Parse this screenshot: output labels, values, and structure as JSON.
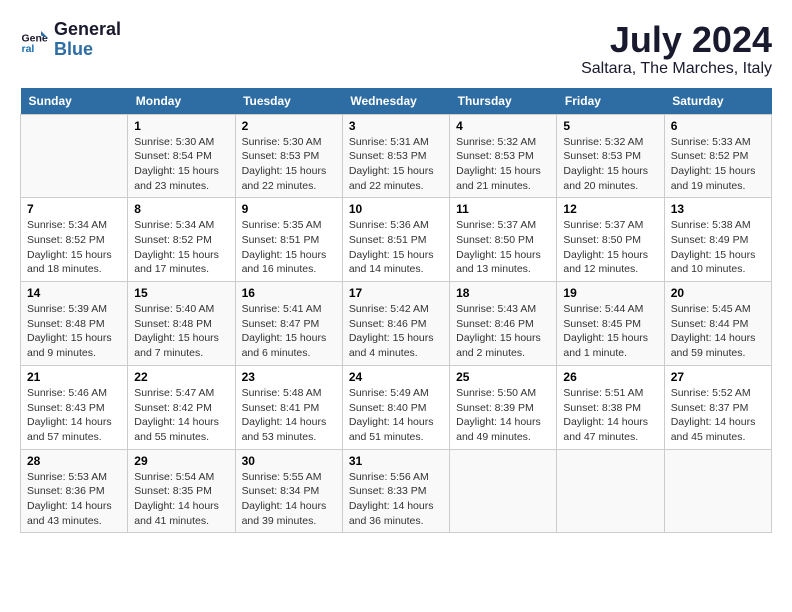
{
  "header": {
    "logo_line1": "General",
    "logo_line2": "Blue",
    "title": "July 2024",
    "subtitle": "Saltara, The Marches, Italy"
  },
  "calendar": {
    "days_of_week": [
      "Sunday",
      "Monday",
      "Tuesday",
      "Wednesday",
      "Thursday",
      "Friday",
      "Saturday"
    ],
    "weeks": [
      [
        {
          "day": "",
          "info": ""
        },
        {
          "day": "1",
          "info": "Sunrise: 5:30 AM\nSunset: 8:54 PM\nDaylight: 15 hours\nand 23 minutes."
        },
        {
          "day": "2",
          "info": "Sunrise: 5:30 AM\nSunset: 8:53 PM\nDaylight: 15 hours\nand 22 minutes."
        },
        {
          "day": "3",
          "info": "Sunrise: 5:31 AM\nSunset: 8:53 PM\nDaylight: 15 hours\nand 22 minutes."
        },
        {
          "day": "4",
          "info": "Sunrise: 5:32 AM\nSunset: 8:53 PM\nDaylight: 15 hours\nand 21 minutes."
        },
        {
          "day": "5",
          "info": "Sunrise: 5:32 AM\nSunset: 8:53 PM\nDaylight: 15 hours\nand 20 minutes."
        },
        {
          "day": "6",
          "info": "Sunrise: 5:33 AM\nSunset: 8:52 PM\nDaylight: 15 hours\nand 19 minutes."
        }
      ],
      [
        {
          "day": "7",
          "info": "Sunrise: 5:34 AM\nSunset: 8:52 PM\nDaylight: 15 hours\nand 18 minutes."
        },
        {
          "day": "8",
          "info": "Sunrise: 5:34 AM\nSunset: 8:52 PM\nDaylight: 15 hours\nand 17 minutes."
        },
        {
          "day": "9",
          "info": "Sunrise: 5:35 AM\nSunset: 8:51 PM\nDaylight: 15 hours\nand 16 minutes."
        },
        {
          "day": "10",
          "info": "Sunrise: 5:36 AM\nSunset: 8:51 PM\nDaylight: 15 hours\nand 14 minutes."
        },
        {
          "day": "11",
          "info": "Sunrise: 5:37 AM\nSunset: 8:50 PM\nDaylight: 15 hours\nand 13 minutes."
        },
        {
          "day": "12",
          "info": "Sunrise: 5:37 AM\nSunset: 8:50 PM\nDaylight: 15 hours\nand 12 minutes."
        },
        {
          "day": "13",
          "info": "Sunrise: 5:38 AM\nSunset: 8:49 PM\nDaylight: 15 hours\nand 10 minutes."
        }
      ],
      [
        {
          "day": "14",
          "info": "Sunrise: 5:39 AM\nSunset: 8:48 PM\nDaylight: 15 hours\nand 9 minutes."
        },
        {
          "day": "15",
          "info": "Sunrise: 5:40 AM\nSunset: 8:48 PM\nDaylight: 15 hours\nand 7 minutes."
        },
        {
          "day": "16",
          "info": "Sunrise: 5:41 AM\nSunset: 8:47 PM\nDaylight: 15 hours\nand 6 minutes."
        },
        {
          "day": "17",
          "info": "Sunrise: 5:42 AM\nSunset: 8:46 PM\nDaylight: 15 hours\nand 4 minutes."
        },
        {
          "day": "18",
          "info": "Sunrise: 5:43 AM\nSunset: 8:46 PM\nDaylight: 15 hours\nand 2 minutes."
        },
        {
          "day": "19",
          "info": "Sunrise: 5:44 AM\nSunset: 8:45 PM\nDaylight: 15 hours\nand 1 minute."
        },
        {
          "day": "20",
          "info": "Sunrise: 5:45 AM\nSunset: 8:44 PM\nDaylight: 14 hours\nand 59 minutes."
        }
      ],
      [
        {
          "day": "21",
          "info": "Sunrise: 5:46 AM\nSunset: 8:43 PM\nDaylight: 14 hours\nand 57 minutes."
        },
        {
          "day": "22",
          "info": "Sunrise: 5:47 AM\nSunset: 8:42 PM\nDaylight: 14 hours\nand 55 minutes."
        },
        {
          "day": "23",
          "info": "Sunrise: 5:48 AM\nSunset: 8:41 PM\nDaylight: 14 hours\nand 53 minutes."
        },
        {
          "day": "24",
          "info": "Sunrise: 5:49 AM\nSunset: 8:40 PM\nDaylight: 14 hours\nand 51 minutes."
        },
        {
          "day": "25",
          "info": "Sunrise: 5:50 AM\nSunset: 8:39 PM\nDaylight: 14 hours\nand 49 minutes."
        },
        {
          "day": "26",
          "info": "Sunrise: 5:51 AM\nSunset: 8:38 PM\nDaylight: 14 hours\nand 47 minutes."
        },
        {
          "day": "27",
          "info": "Sunrise: 5:52 AM\nSunset: 8:37 PM\nDaylight: 14 hours\nand 45 minutes."
        }
      ],
      [
        {
          "day": "28",
          "info": "Sunrise: 5:53 AM\nSunset: 8:36 PM\nDaylight: 14 hours\nand 43 minutes."
        },
        {
          "day": "29",
          "info": "Sunrise: 5:54 AM\nSunset: 8:35 PM\nDaylight: 14 hours\nand 41 minutes."
        },
        {
          "day": "30",
          "info": "Sunrise: 5:55 AM\nSunset: 8:34 PM\nDaylight: 14 hours\nand 39 minutes."
        },
        {
          "day": "31",
          "info": "Sunrise: 5:56 AM\nSunset: 8:33 PM\nDaylight: 14 hours\nand 36 minutes."
        },
        {
          "day": "",
          "info": ""
        },
        {
          "day": "",
          "info": ""
        },
        {
          "day": "",
          "info": ""
        }
      ]
    ]
  }
}
